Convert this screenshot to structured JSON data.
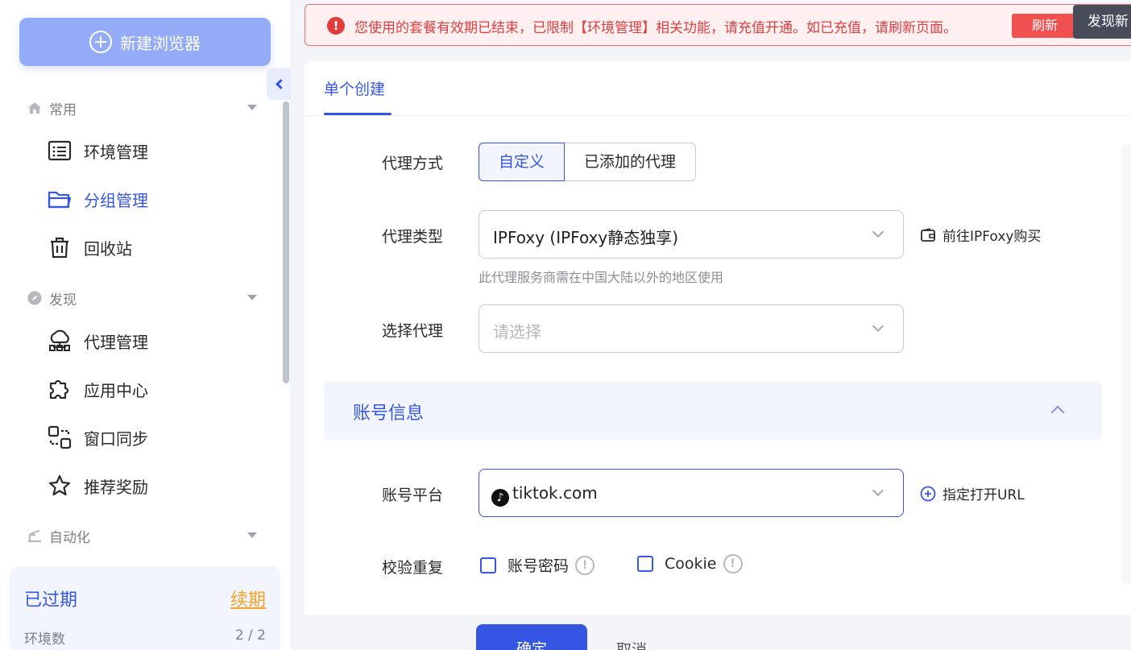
{
  "sidebar": {
    "new_browser_label": "新建浏览器",
    "sections": {
      "common": "常用",
      "discover": "发现",
      "automation": "自动化"
    },
    "items": {
      "env_manage": "环境管理",
      "group_manage": "分组管理",
      "recycle_bin": "回收站",
      "proxy_manage": "代理管理",
      "app_center": "应用中心",
      "window_sync": "窗口同步",
      "referral_reward": "推荐奖励"
    },
    "plan": {
      "status": "已过期",
      "renew": "续期",
      "env_count_label": "环境数",
      "env_count_value": "2 / 2"
    }
  },
  "alert": {
    "message": "您使用的套餐有效期已结束，已限制【环境管理】相关功能，请充值开通。如已充值，请刷新页面。",
    "refresh_label": "刷新",
    "found_tag": "发现新"
  },
  "form": {
    "tab": "单个创建",
    "proxy_mode_label": "代理方式",
    "proxy_mode_options": [
      "自定义",
      "已添加的代理"
    ],
    "proxy_mode_selected": "自定义",
    "proxy_type_label": "代理类型",
    "proxy_type_value": "IPFoxy (IPFoxy静态独享)",
    "proxy_type_hint": "此代理服务商需在中国大陆以外的地区使用",
    "buy_link": "前往IPFoxy购买",
    "select_proxy_label": "选择代理",
    "select_proxy_placeholder": "请选择",
    "account_section": "账号信息",
    "platform_label": "账号平台",
    "platform_value": "tiktok.com",
    "open_url_link": "指定打开URL",
    "dedupe_label": "校验重复",
    "dedupe_options": [
      "账号密码",
      "Cookie"
    ],
    "confirm_label": "确定",
    "cancel_label": "取消"
  },
  "colors": {
    "accent": "#3556e2",
    "alert_red": "#e03e3e",
    "renew_orange": "#f5a524"
  }
}
